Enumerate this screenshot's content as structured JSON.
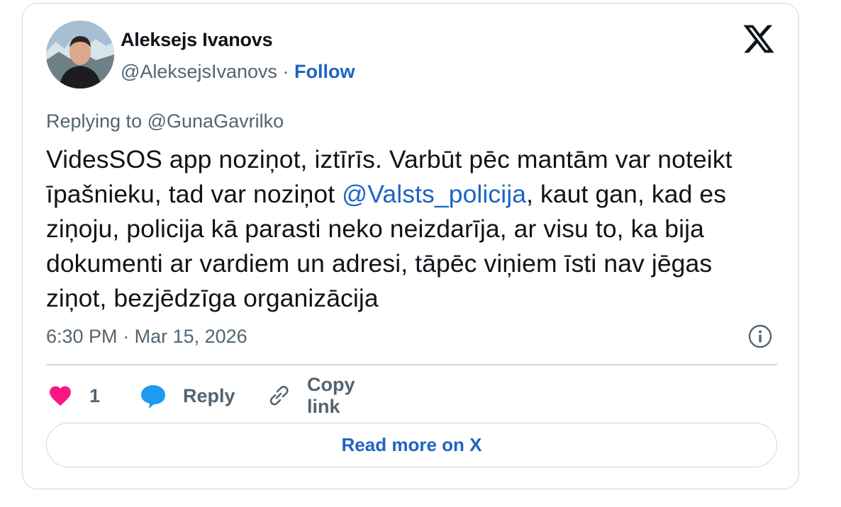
{
  "author": {
    "name": "Aleksejs Ivanovs",
    "handle": "@AleksejsIvanovs",
    "separator": "·",
    "follow_label": "Follow"
  },
  "replying": {
    "prefix": "Replying to",
    "handle": "@GunaGavrilko"
  },
  "tweet": {
    "text_part1": "VidesSOS app noziņot, iztīrīs. Varbūt pēc mantām var noteikt īpašnieku, tad var noziņot ",
    "mention": "@Valsts_policija",
    "text_part2": ", kaut gan, kad es ziņoju, policija kā parasti neko neizdarīja, ar visu to, ka bija dokumenti ar vardiem un adresi, tāpēc viņiem īsti nav jēgas ziņot, bezjēdzīga organizācija"
  },
  "timestamp": {
    "time": "6:30 PM",
    "separator": "·",
    "date": "Mar 15, 2026"
  },
  "actions": {
    "like_count": "1",
    "reply_label": "Reply",
    "copy_link_label": "Copy link"
  },
  "read_more_label": "Read more on X",
  "colors": {
    "link": "#1d64c4",
    "heart": "#f91880",
    "reply_bubble": "#1d9bf0",
    "muted_text": "#536471",
    "border": "#cfd9de"
  },
  "icons": [
    "x-logo-icon",
    "info-icon",
    "heart-icon",
    "reply-bubble-icon",
    "link-icon"
  ]
}
